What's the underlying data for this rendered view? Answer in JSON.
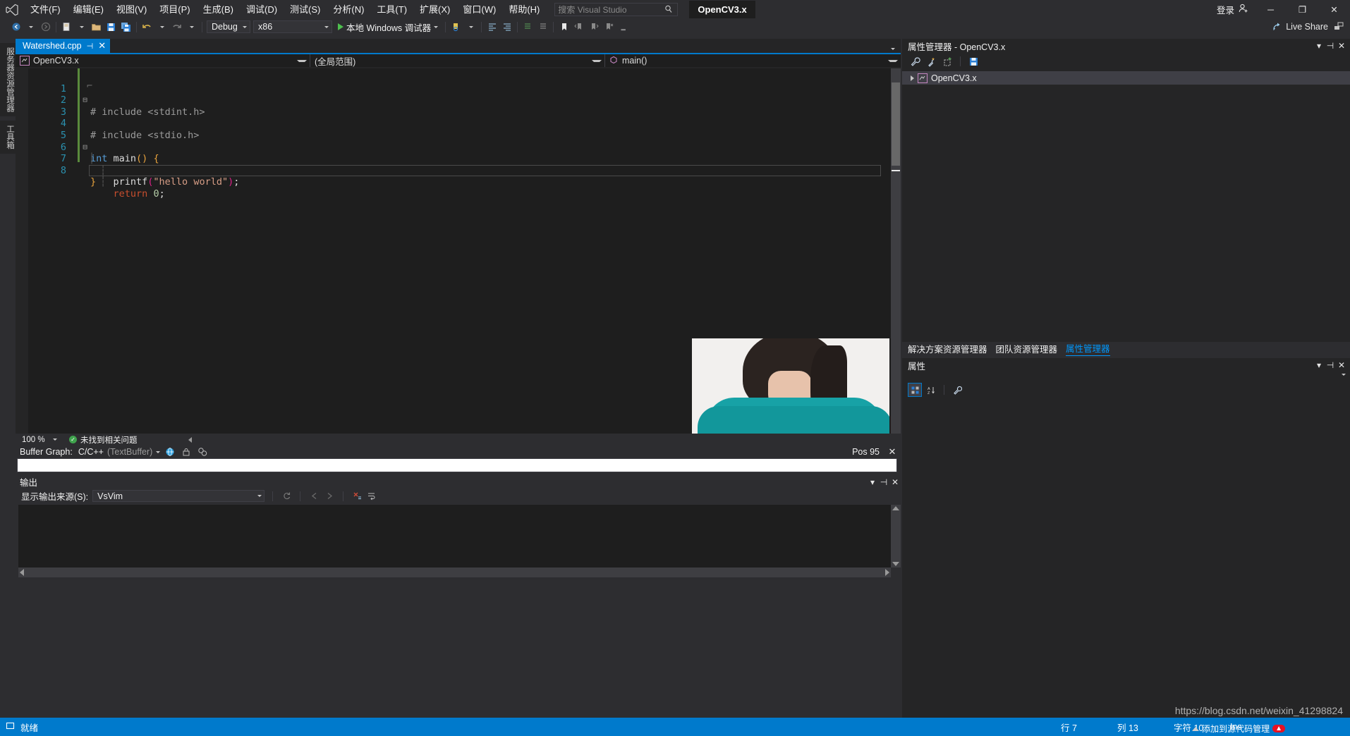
{
  "titlebar": {
    "logo_icon": "visual-studio-logo",
    "menus": [
      {
        "label": "文件(F)"
      },
      {
        "label": "编辑(E)"
      },
      {
        "label": "视图(V)"
      },
      {
        "label": "项目(P)"
      },
      {
        "label": "生成(B)"
      },
      {
        "label": "调试(D)"
      },
      {
        "label": "测试(S)"
      },
      {
        "label": "分析(N)"
      },
      {
        "label": "工具(T)"
      },
      {
        "label": "扩展(X)"
      },
      {
        "label": "窗口(W)"
      },
      {
        "label": "帮助(H)"
      }
    ],
    "search_placeholder": "搜索 Visual Studio",
    "search_value": "",
    "search_icon": "magnifier-icon",
    "project_badge": "OpenCV3.x",
    "signin_label": "登录",
    "signin_icon": "account-add-icon",
    "minimize": "─",
    "maximize": "❐",
    "close": "✕"
  },
  "toolbar": {
    "back_icon": "navigate-back-icon",
    "forward_icon": "navigate-forward-icon",
    "new_icon": "new-file-icon",
    "open_icon": "open-folder-icon",
    "save_icon": "save-icon",
    "saveall_icon": "save-all-icon",
    "undo_icon": "undo-icon",
    "redo_icon": "redo-icon",
    "config_value": "Debug",
    "platform_value": "x86",
    "run_label": "本地 Windows 调试器",
    "run_icon": "play-icon",
    "find_icon": "find-icon",
    "step_icons": [
      "indent-icon",
      "outdent-icon",
      "comment-icon",
      "uncomment-icon",
      "bookmark-icon",
      "prev-bookmark-icon",
      "next-bookmark-icon",
      "clear-bookmark-icon"
    ],
    "liveshare_label": "Live Share",
    "liveshare_icon": "share-icon",
    "feedback_icon": "feedback-icon"
  },
  "rail": {
    "items": [
      {
        "label": "服务器资源管理器"
      },
      {
        "label": "工具箱"
      }
    ]
  },
  "editor": {
    "tab": {
      "label": "Watershed.cpp",
      "pin_icon": "pin-icon",
      "close_icon": "close-icon"
    },
    "nav": {
      "project": "OpenCV3.x",
      "project_icon": "project-icon",
      "scope": "(全局范围)",
      "member": "main()",
      "member_icon": "method-icon"
    },
    "lines": [
      {
        "n": "1",
        "fold": "⊟",
        "tokens": [
          {
            "t": "# include <stdint.h>",
            "c": "c-pre"
          }
        ]
      },
      {
        "n": "2",
        "fold": "",
        "tokens": [
          {
            "t": "# include <stdio.h>",
            "c": "c-pre"
          }
        ]
      },
      {
        "n": "3",
        "fold": "",
        "tokens": []
      },
      {
        "n": "4",
        "fold": "",
        "tokens": []
      },
      {
        "n": "5",
        "fold": "⊟",
        "tokens": [
          {
            "t": "int",
            "c": "c-kw"
          },
          {
            "t": " ",
            "c": "c-id"
          },
          {
            "t": "main",
            "c": "c-id"
          },
          {
            "t": "()",
            "c": "c-par"
          },
          {
            "t": " ",
            "c": "c-id"
          },
          {
            "t": "{",
            "c": "c-par"
          }
        ]
      },
      {
        "n": "6",
        "fold": "",
        "tokens": [
          {
            "t": "    printf",
            "c": "c-id"
          },
          {
            "t": "(",
            "c": "c-mag"
          },
          {
            "t": "\"hello world\"",
            "c": "c-str"
          },
          {
            "t": ")",
            "c": "c-mag"
          },
          {
            "t": ";",
            "c": "c-id"
          }
        ]
      },
      {
        "n": "7",
        "fold": "",
        "tokens": [
          {
            "t": "    ",
            "c": "c-id"
          },
          {
            "t": "return",
            "c": "c-ret"
          },
          {
            "t": " ",
            "c": "c-id"
          },
          {
            "t": "0",
            "c": "c-num"
          },
          {
            "t": ";",
            "c": "c-id"
          }
        ]
      },
      {
        "n": "8",
        "fold": "",
        "tokens": [
          {
            "t": "}",
            "c": "c-par"
          }
        ]
      }
    ],
    "current_line_index": 6,
    "zoom_level": "100 %",
    "issues_status": "未找到相关问题",
    "issues_icon": "check-ok-icon"
  },
  "buffergraph": {
    "label": "Buffer Graph:",
    "value": "C/C++",
    "value_dim": "(TextBuffer)",
    "icons": [
      "globe-icon",
      "lock-icon",
      "graph-icon"
    ],
    "pos_label": "Pos 95",
    "close_icon": "close-icon",
    "input_value": ""
  },
  "output": {
    "title": "输出",
    "source_label": "显示输出来源(S):",
    "source_value": "VsVim",
    "tool_icons": [
      "rerun-icon",
      "back-icon",
      "forward-icon",
      "clear-icon",
      "wordwrap-icon"
    ],
    "dropdown_icon": "chevron-down-icon",
    "pin_icon": "pin-icon",
    "close_icon": "close-icon",
    "body_text": ""
  },
  "property_manager": {
    "title": "属性管理器 - OpenCV3.x",
    "caret_icon": "chevron-down-icon",
    "pin_icon": "pin-icon",
    "close_icon": "close-icon",
    "tools": [
      "wrench-icon",
      "wrench-sparkle-icon",
      "add-sheet-icon",
      "save-icon"
    ],
    "tree": [
      {
        "label": "OpenCV3.x",
        "expander": "▶",
        "icon": "project-icon"
      }
    ]
  },
  "right_tabs": [
    {
      "label": "解决方案资源管理器",
      "active": false
    },
    {
      "label": "团队资源管理器",
      "active": false
    },
    {
      "label": "属性管理器",
      "active": true
    }
  ],
  "properties": {
    "title": "属性",
    "caret_icon": "chevron-down-icon",
    "pin_icon": "pin-icon",
    "close_icon": "close-icon",
    "tools": [
      "categorized-icon",
      "alphabetical-icon",
      "properties-icon"
    ]
  },
  "statusbar": {
    "state": "就绪",
    "state_icon": "ready-icon",
    "row_label": "行 7",
    "col_label": "列 13",
    "char_label": "字符 10",
    "insert_mode": "Ins"
  },
  "watermark": {
    "url": "https://blog.csdn.net/weixin_41298824",
    "toast_label": "添加到源代码管理",
    "toast_badge": "▲"
  },
  "colors": {
    "accent": "#007acc",
    "titlebar_bg": "#2d2d30",
    "editor_bg": "#1e1e1e",
    "panel_bg": "#252526",
    "status_bg": "#007acc"
  }
}
